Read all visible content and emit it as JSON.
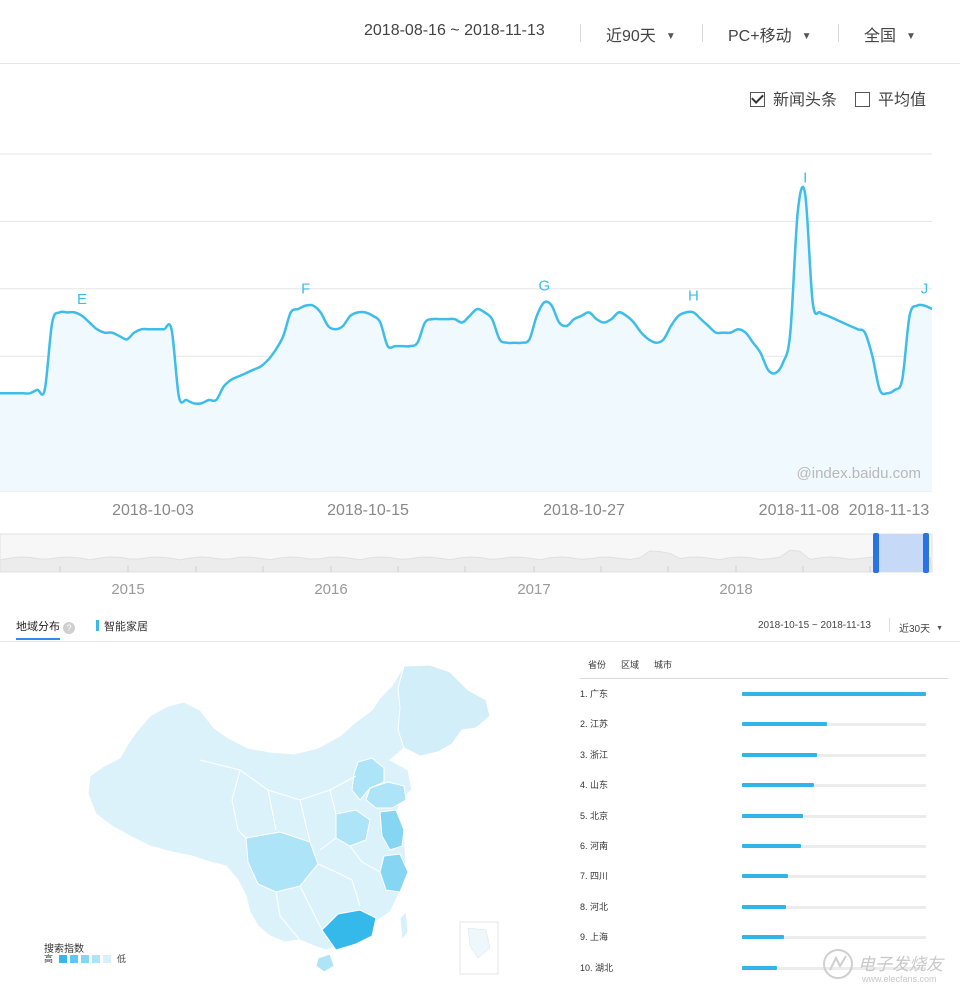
{
  "filters": {
    "date_range": "2018-08-16 ~ 2018-11-13",
    "period": "近90天",
    "device": "PC+移动",
    "area": "全国"
  },
  "legend": {
    "series_label": "新闻头条",
    "series_checked": true,
    "average_label": "平均值",
    "average_checked": false
  },
  "watermark_chart": "@index.baidu.com",
  "chart_data": {
    "type": "area",
    "x_ticks": [
      "2018-10-03",
      "2018-10-15",
      "2018-10-27",
      "2018-11-08",
      "2018-11-13"
    ],
    "values": [
      29,
      29,
      29,
      29,
      29,
      30,
      30,
      50,
      53,
      53,
      53,
      52,
      50,
      48,
      47,
      47,
      46,
      45,
      47,
      48,
      48,
      48,
      48,
      48,
      28,
      27,
      26,
      26,
      27,
      27,
      31,
      33,
      34,
      35,
      36,
      37,
      39,
      42,
      46,
      53,
      54,
      55,
      55,
      53,
      49,
      48,
      49,
      52,
      53,
      53,
      52,
      50,
      43,
      43,
      43,
      43,
      44,
      50,
      51,
      51,
      51,
      51,
      50,
      52,
      54,
      53,
      51,
      45,
      44,
      44,
      44,
      45,
      52,
      56,
      55,
      50,
      49,
      51,
      52,
      53,
      51,
      50,
      51,
      53,
      52,
      50,
      47,
      45,
      44,
      45,
      49,
      52,
      53,
      53,
      51,
      49,
      47,
      47,
      47,
      48,
      47,
      44,
      41,
      36,
      35,
      38,
      47,
      83,
      88,
      56,
      53,
      52,
      51,
      50,
      49,
      48,
      47,
      40,
      30,
      29,
      30,
      33,
      52,
      55,
      55,
      54
    ],
    "annotations": [
      {
        "label": "E",
        "index": 11
      },
      {
        "label": "F",
        "index": 41
      },
      {
        "label": "G",
        "index": 73
      },
      {
        "label": "H",
        "index": 93
      },
      {
        "label": "I",
        "index": 108
      },
      {
        "label": "J",
        "index": 124
      }
    ],
    "ylim": [
      0,
      100
    ],
    "grid": true,
    "color": "#3fbde9",
    "fill": "#f0f9fd"
  },
  "overview_axis": {
    "years": [
      "2015",
      "2016",
      "2017",
      "2018"
    ]
  },
  "region": {
    "tab_label": "地域分布",
    "help_icon": "help-icon",
    "keyword": "智能家居",
    "date_range": "2018-10-15 ~ 2018-11-13",
    "period": "近30天",
    "tabs": [
      "省份",
      "区域",
      "城市"
    ],
    "legend_title": "搜索指数",
    "legend_high": "高",
    "legend_low": "低",
    "legend_colors": [
      "#35b8ea",
      "#5ec8ef",
      "#86d6f3",
      "#aee4f7",
      "#d6f1fb"
    ],
    "ranking": [
      {
        "rank": "1.",
        "name": "广东",
        "value": 100
      },
      {
        "rank": "2.",
        "name": "江苏",
        "value": 46
      },
      {
        "rank": "3.",
        "name": "浙江",
        "value": 41
      },
      {
        "rank": "4.",
        "name": "山东",
        "value": 39
      },
      {
        "rank": "5.",
        "name": "北京",
        "value": 33
      },
      {
        "rank": "6.",
        "name": "河南",
        "value": 32
      },
      {
        "rank": "7.",
        "name": "四川",
        "value": 25
      },
      {
        "rank": "8.",
        "name": "河北",
        "value": 24
      },
      {
        "rank": "9.",
        "name": "上海",
        "value": 23
      },
      {
        "rank": "10.",
        "name": "湖北",
        "value": 19
      }
    ]
  },
  "watermark": {
    "title": "电子发烧友",
    "url": "www.elecfans.com"
  }
}
